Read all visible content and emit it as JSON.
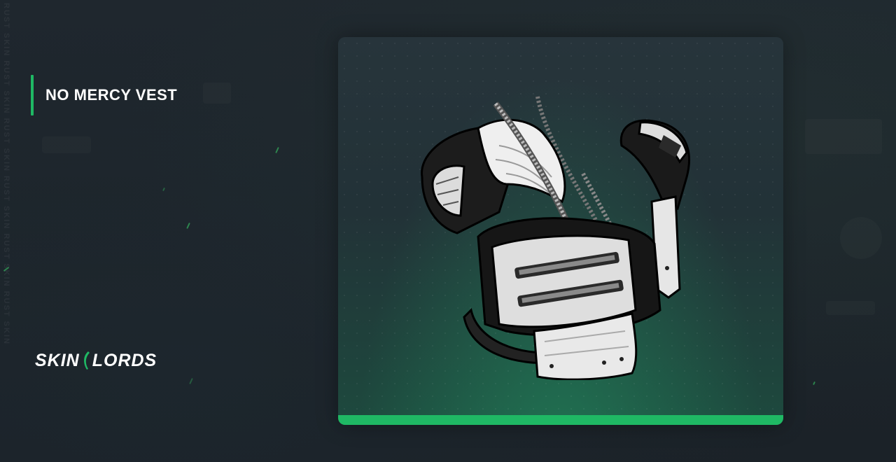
{
  "background": {
    "watermark_text": "RUST SKIN RUST SKIN RUST SKIN RUST SKIN RUST SKIN RUST SKIN",
    "base_color": "#1c232a"
  },
  "title": {
    "text": "NO MERCY VEST",
    "accent_color": "#1fb864"
  },
  "logo": {
    "part1": "SKIN",
    "part2": "LORDS",
    "icon": "sickle-logo-icon"
  },
  "item_card": {
    "image_icon": "armored-vest-icon",
    "accent_bar_color": "#1fb864"
  }
}
